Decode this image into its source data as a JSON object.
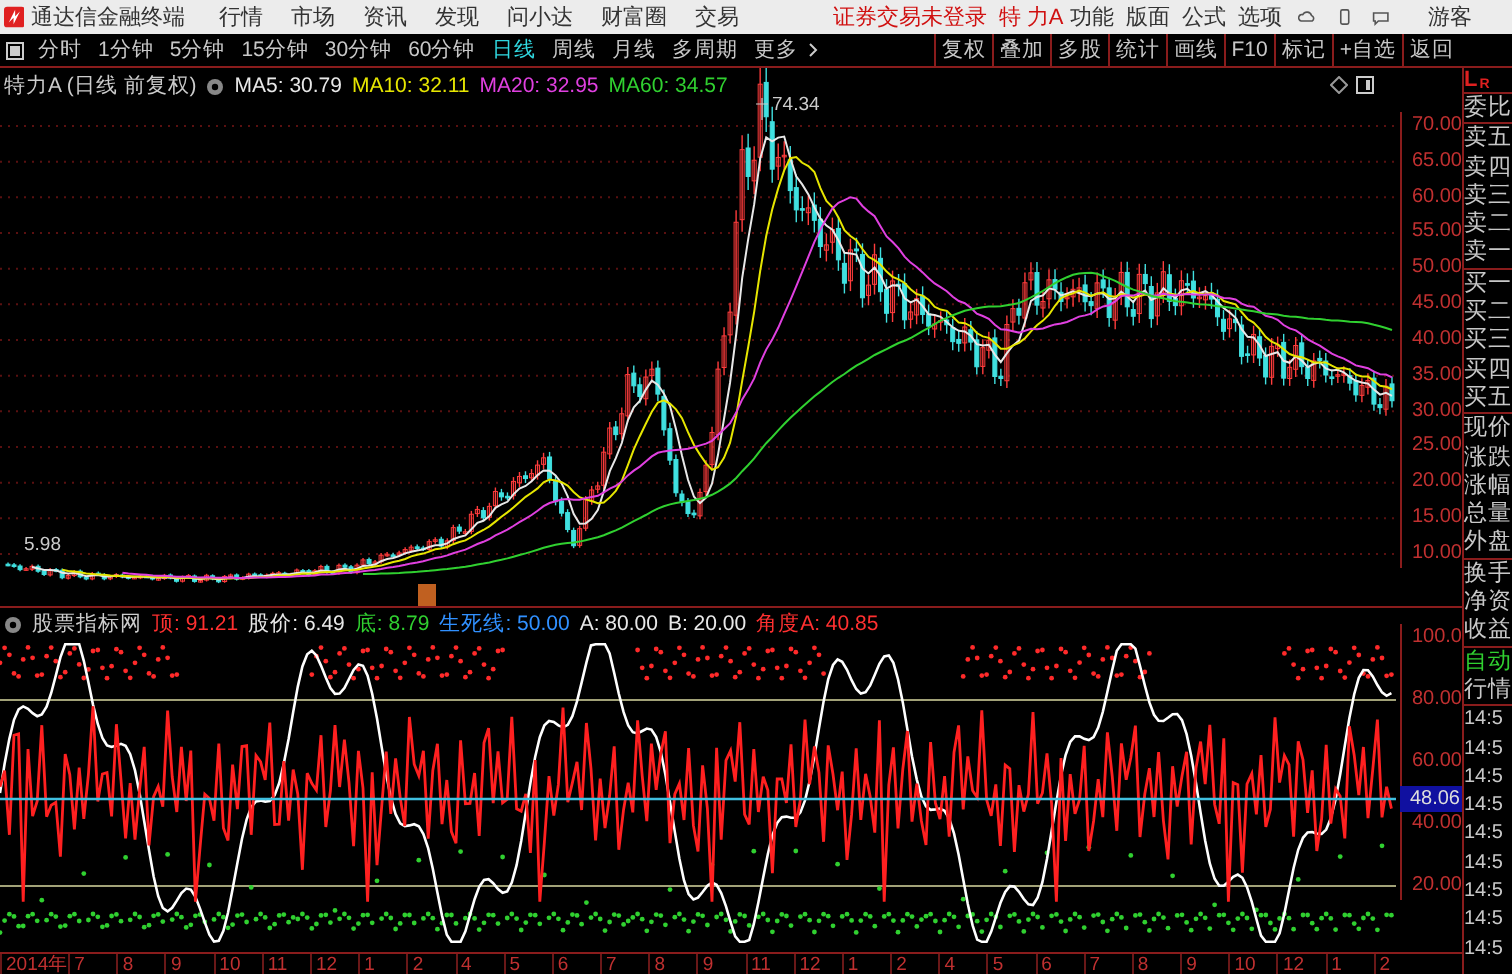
{
  "title_bar": {
    "app_name": "通达信金融终端",
    "menu": [
      "行情",
      "市场",
      "资讯",
      "发现",
      "问小达",
      "财富圈",
      "交易"
    ],
    "login_status": "证券交易未登录",
    "stock_name": "特 力A",
    "right_menu": [
      "功能",
      "版面",
      "公式",
      "选项"
    ],
    "user": "游客"
  },
  "period_tabs": [
    {
      "label": "分时",
      "selected": false
    },
    {
      "label": "1分钟",
      "selected": false
    },
    {
      "label": "5分钟",
      "selected": false
    },
    {
      "label": "15分钟",
      "selected": false
    },
    {
      "label": "30分钟",
      "selected": false
    },
    {
      "label": "60分钟",
      "selected": false
    },
    {
      "label": "日线",
      "selected": true
    },
    {
      "label": "周线",
      "selected": false
    },
    {
      "label": "月线",
      "selected": false
    },
    {
      "label": "多周期",
      "selected": false
    },
    {
      "label": "更多",
      "selected": false
    }
  ],
  "tools": [
    "复权",
    "叠加",
    "多股",
    "统计",
    "画线",
    "F10",
    "标记",
    "+自选",
    "返回"
  ],
  "price_chart": {
    "title": "特力A (日线 前复权)",
    "ma": [
      {
        "label": "MA5: 30.79",
        "color": "#e8e8e8"
      },
      {
        "label": "MA10: 32.11",
        "color": "#e6e600"
      },
      {
        "label": "MA20: 32.95",
        "color": "#e040e0"
      },
      {
        "label": "MA60: 34.57",
        "color": "#30d030"
      }
    ],
    "high_label": "74.34",
    "low_label": "5.98",
    "axis": [
      "70.00",
      "65.00",
      "60.00",
      "55.00",
      "50.00",
      "45.00",
      "40.00",
      "35.00",
      "30.00",
      "25.00",
      "20.00",
      "15.00",
      "10.00"
    ]
  },
  "indicator": {
    "name": "股票指标网",
    "values": [
      {
        "label": "顶: 91.21",
        "color": "#ff3030"
      },
      {
        "label": "股价: 6.49",
        "color": "#e8e8e8"
      },
      {
        "label": "底: 8.79",
        "color": "#30d030"
      },
      {
        "label": "生死线: 50.00",
        "color": "#3090ff"
      },
      {
        "label": "A: 80.00",
        "color": "#e8e8e8"
      },
      {
        "label": "B: 20.00",
        "color": "#e8e8e8"
      },
      {
        "label": "角度A: 40.85",
        "color": "#ff3030"
      }
    ],
    "axis": [
      "100.0",
      "80.00",
      "60.00",
      "40.00",
      "20.00"
    ],
    "current": "48.06"
  },
  "date_axis": [
    "2014年",
    "7",
    "8",
    "9",
    "10",
    "11",
    "12",
    "1",
    "2",
    "4",
    "5",
    "6",
    "7",
    "8",
    "9",
    "11",
    "12",
    "1",
    "2",
    "4",
    "5",
    "6",
    "7",
    "8",
    "9",
    "10",
    "12",
    "1",
    "2"
  ],
  "quote_panel": {
    "corner": [
      "L",
      "R"
    ],
    "groups": [
      [
        "委比"
      ],
      [
        "卖五",
        "卖四",
        "卖三",
        "卖二",
        "卖一"
      ],
      [
        "买一",
        "买二",
        "买三",
        "买四",
        "买五"
      ],
      [
        "现价",
        "涨跌",
        "涨幅",
        "总量",
        "外盘"
      ],
      [
        "换手",
        "净资",
        "收益"
      ]
    ],
    "mode": "自动",
    "section": "行情",
    "times": [
      "14:5",
      "14:5",
      "14:5",
      "14:5",
      "14:5",
      "14:5",
      "14:5",
      "14:5",
      "14:5"
    ]
  }
}
